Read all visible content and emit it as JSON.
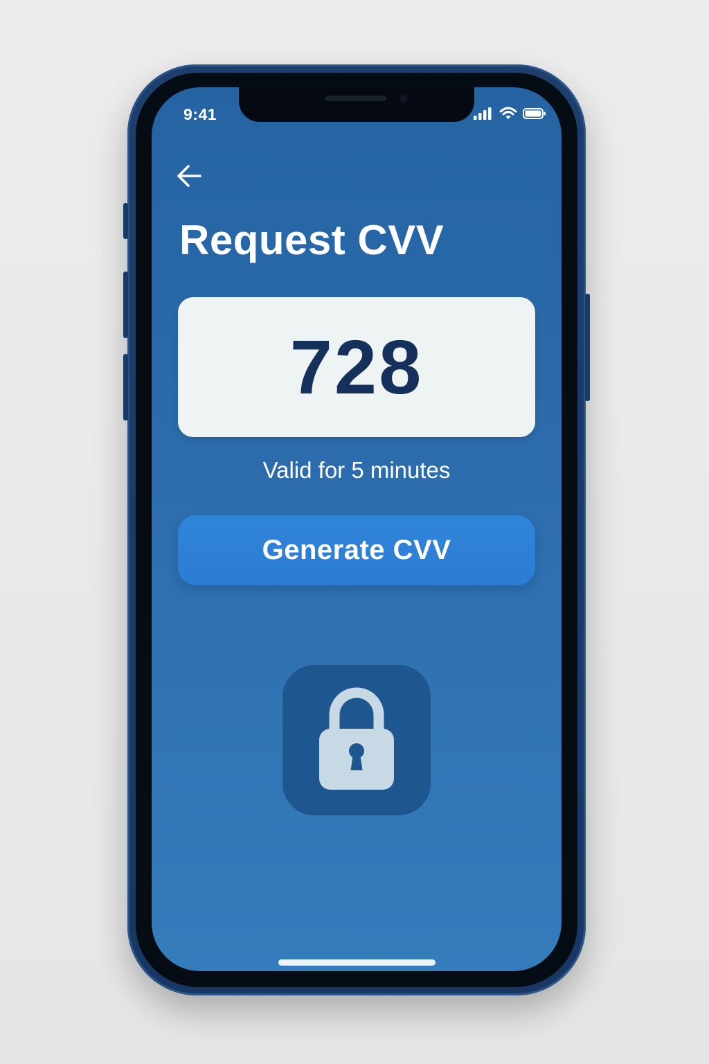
{
  "status_bar": {
    "time": "9:41",
    "icons": [
      "signal-icon",
      "wifi-icon",
      "battery-icon"
    ]
  },
  "header": {
    "back_icon": "arrow-left-icon",
    "title": "Request CVV"
  },
  "cvv": {
    "value": "728",
    "validity": "Valid for 5 minutes"
  },
  "actions": {
    "generate_label": "Generate CVV"
  },
  "illustration": {
    "icon": "lock-icon"
  },
  "colors": {
    "screen_background": "#2d6dad",
    "card_background": "#eef3f4",
    "cvv_text": "#15305a",
    "button_background": "#2b7dd4",
    "lock_tile": "#1e5690",
    "lock_body": "#c8d9e6"
  }
}
